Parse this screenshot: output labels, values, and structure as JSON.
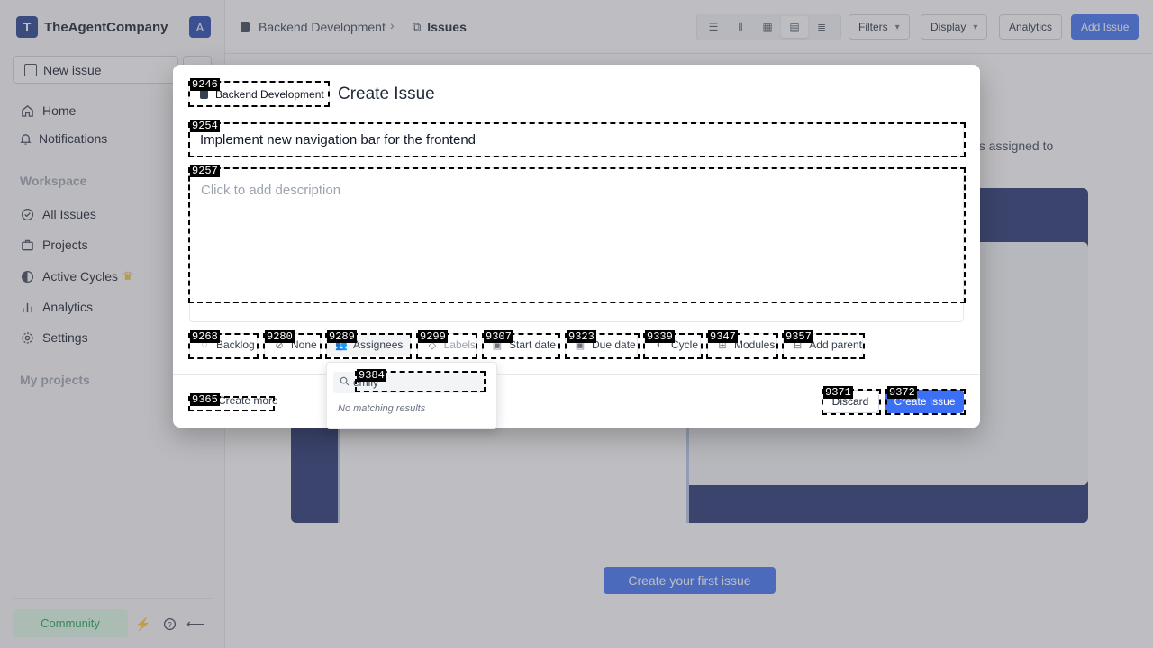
{
  "sidebar": {
    "workspace_initial": "T",
    "workspace_name": "TheAgentCompany",
    "user_initial": "A",
    "new_issue": "New issue",
    "nav": [
      {
        "label": "Home",
        "icon": "home-icon"
      },
      {
        "label": "Notifications",
        "icon": "bell-icon"
      }
    ],
    "workspace_label": "Workspace",
    "workspace_items": [
      {
        "label": "All Issues",
        "icon": "check-circle-icon"
      },
      {
        "label": "Projects",
        "icon": "briefcase-icon"
      },
      {
        "label": "Active Cycles",
        "icon": "cycle-icon"
      },
      {
        "label": "Analytics",
        "icon": "bar-chart-icon"
      },
      {
        "label": "Settings",
        "icon": "gear-icon"
      }
    ],
    "my_projects_label": "My projects",
    "community": "Community"
  },
  "header": {
    "project": "Backend Development",
    "page": "Issues",
    "filters": "Filters",
    "display": "Display",
    "analytics": "Analytics",
    "add_issue": "Add Issue"
  },
  "background": {
    "empty_text": "es assigned to",
    "create_first": "Create your first issue"
  },
  "modal": {
    "project": "Backend Development",
    "title": "Create Issue",
    "issue_title_value": "Implement new navigation bar for the frontend",
    "description_placeholder": "Click to add description",
    "properties": [
      {
        "label": "Backlog",
        "icon": "state-icon"
      },
      {
        "label": "None",
        "icon": "priority-icon"
      },
      {
        "label": "Assignees",
        "icon": "users-icon"
      },
      {
        "label": "Labels",
        "icon": "tag-icon"
      },
      {
        "label": "Start date",
        "icon": "calendar-icon"
      },
      {
        "label": "Due date",
        "icon": "calendar-icon"
      },
      {
        "label": "Cycle",
        "icon": "cycle-icon"
      },
      {
        "label": "Modules",
        "icon": "modules-icon"
      },
      {
        "label": "Add parent",
        "icon": "parent-icon"
      }
    ],
    "create_more": "Create more",
    "discard": "Discard",
    "create": "Create Issue"
  },
  "dropdown": {
    "search_value": "emily",
    "empty": "No matching results"
  },
  "marks": {
    "project_chip": "9246",
    "title_input": "9254",
    "description": "9257",
    "state": "9268",
    "priority": "9280",
    "assignees": "9289",
    "labels": "9299",
    "start_date": "9307",
    "due_date": "9323",
    "cycle": "9339",
    "modules": "9347",
    "parent": "9357",
    "create_more": "9365",
    "discard": "9371",
    "create": "9372",
    "search": "9384"
  },
  "colors": {
    "primary": "#3b6ff5",
    "workspace_logo": "#1e3a8a",
    "community_bg": "#dcfce7",
    "community_text": "#16a34a"
  }
}
